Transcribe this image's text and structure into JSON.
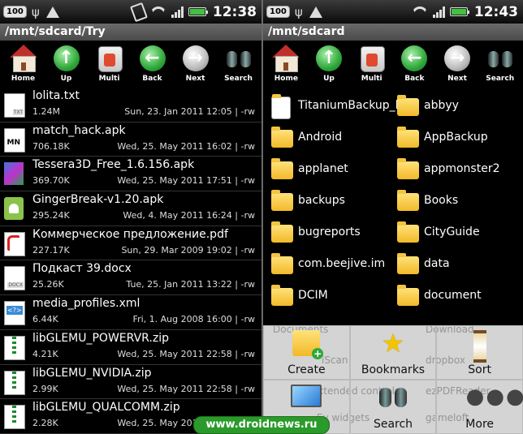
{
  "left": {
    "status": {
      "badge": "100",
      "time": "12:38",
      "battery_color": "#3fc33f"
    },
    "path": "/mnt/sdcard/Try",
    "toolbar": [
      {
        "label": "Home",
        "icon": "home-icon"
      },
      {
        "label": "Up",
        "icon": "up-arrow-icon"
      },
      {
        "label": "Multi",
        "icon": "multi-select-icon"
      },
      {
        "label": "Back",
        "icon": "back-arrow-icon"
      },
      {
        "label": "Next",
        "icon": "next-arrow-icon"
      },
      {
        "label": "Search",
        "icon": "binoculars-icon"
      }
    ],
    "files": [
      {
        "name": "lolita.txt",
        "size": "1.24M",
        "date": "Sun, 23. Jan 2011 12:05 | -rw",
        "icon": "text-file-icon"
      },
      {
        "name": "match_hack.apk",
        "size": "706.18K",
        "date": "Wed, 25. May 2011 16:02 | -rw",
        "icon": "apk-icon"
      },
      {
        "name": "Tessera3D_Free_1.6.156.apk",
        "size": "369.70K",
        "date": "Wed, 25. May 2011 17:51 | -rw",
        "icon": "apk-icon"
      },
      {
        "name": "GingerBreak-v1.20.apk",
        "size": "295.24K",
        "date": "Wed, 4. May 2011 16:24 | -rw",
        "icon": "android-icon"
      },
      {
        "name": "Коммерческое предложение.pdf",
        "size": "227.17K",
        "date": "Sun, 29. Mar 2009 19:02 | -rw",
        "icon": "pdf-icon"
      },
      {
        "name": "Подкаст 39.docx",
        "size": "25.26K",
        "date": "Tue, 25. Jan 2011 13:22 | -rw",
        "icon": "docx-icon"
      },
      {
        "name": "media_profiles.xml",
        "size": "6.44K",
        "date": "Fri, 1. Aug 2008 16:00 | -rw",
        "icon": "xml-icon"
      },
      {
        "name": "libGLEMU_POWERVR.zip",
        "size": "4.21K",
        "date": "Wed, 25. May 2011 22:58 | -rw",
        "icon": "zip-icon"
      },
      {
        "name": "libGLEMU_NVIDIA.zip",
        "size": "2.99K",
        "date": "Wed, 25. May 2011 22:58 | -rw",
        "icon": "zip-icon"
      },
      {
        "name": "libGLEMU_QUALCOMM.zip",
        "size": "2.28K",
        "date": "Wed, 25. May 2011 22:58 | -rw",
        "icon": "zip-icon"
      }
    ]
  },
  "right": {
    "status": {
      "badge": "100",
      "time": "12:43"
    },
    "path": "/mnt/sdcard",
    "toolbar": [
      {
        "label": "Home"
      },
      {
        "label": "Up"
      },
      {
        "label": "Multi"
      },
      {
        "label": "Back"
      },
      {
        "label": "Next"
      },
      {
        "label": "Search"
      }
    ],
    "items": [
      {
        "name": "TitaniumBackup_li",
        "type": "file"
      },
      {
        "name": "abbyy",
        "type": "folder"
      },
      {
        "name": "Android",
        "type": "folder"
      },
      {
        "name": "AppBackup",
        "type": "folder"
      },
      {
        "name": "applanet",
        "type": "folder"
      },
      {
        "name": "appmonster2",
        "type": "folder"
      },
      {
        "name": "backups",
        "type": "folder"
      },
      {
        "name": "Books",
        "type": "folder"
      },
      {
        "name": "bugreports",
        "type": "folder"
      },
      {
        "name": "CityGuide",
        "type": "folder"
      },
      {
        "name": "com.beejive.im",
        "type": "folder"
      },
      {
        "name": "data",
        "type": "folder"
      },
      {
        "name": "DCIM",
        "type": "folder"
      },
      {
        "name": "document",
        "type": "folder"
      }
    ],
    "menu": [
      {
        "label": "Create",
        "icon": "create-folder-icon"
      },
      {
        "label": "Bookmarks",
        "icon": "star-icon"
      },
      {
        "label": "Sort",
        "icon": "hourglass-icon"
      },
      {
        "label": "",
        "icon": "monitor-icon"
      },
      {
        "label": "Search",
        "icon": "binoculars-icon"
      },
      {
        "label": "More",
        "icon": "more-icon"
      }
    ],
    "ghost_items": [
      "Documents",
      "Download",
      "dropbox",
      "iScan",
      "extended controls",
      "ezPDFReader",
      "Ey widgets",
      "gameloft"
    ]
  },
  "watermark": "www.droidnews.ru"
}
